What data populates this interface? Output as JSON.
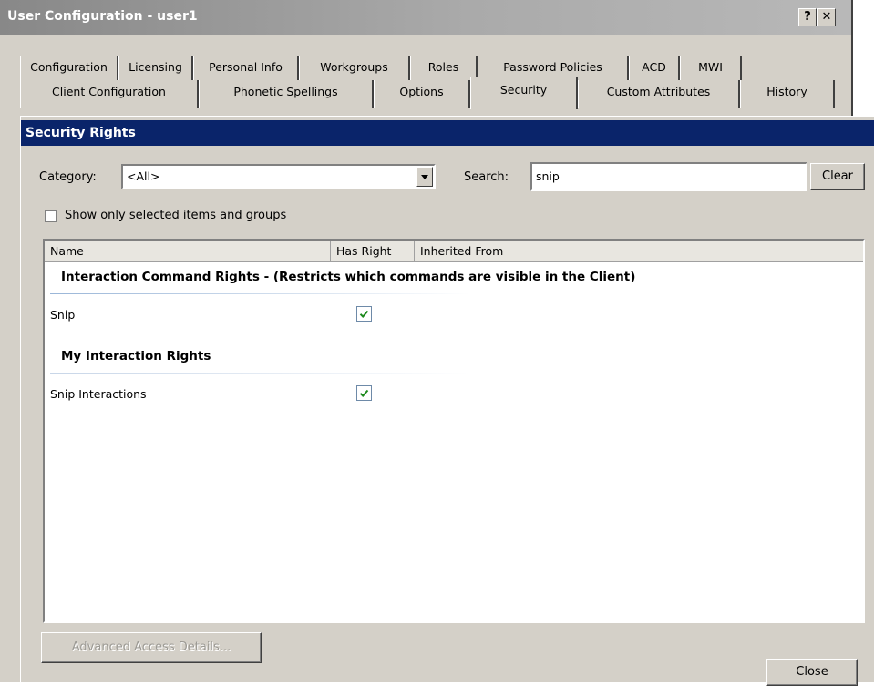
{
  "window": {
    "title": "User Configuration - user1",
    "help_label": "?",
    "close_label": "✕"
  },
  "tabs_row1": [
    "Configuration",
    "Licensing",
    "Personal Info",
    "Workgroups",
    "Roles",
    "Password Policies",
    "ACD",
    "MWI"
  ],
  "tabs_row2": [
    "Client Configuration",
    "Phonetic Spellings",
    "Options",
    "Security",
    "Custom Attributes",
    "History"
  ],
  "active_tab": "Security",
  "section": {
    "title": "Security Rights"
  },
  "filters": {
    "category_label": "Category:",
    "category_value": "<All>",
    "search_label": "Search:",
    "search_value": "snip",
    "clear_label": "Clear",
    "show_selected_label": "Show only selected items and groups",
    "show_selected_checked": false
  },
  "table": {
    "columns": [
      "Name",
      "Has Right",
      "Inherited From"
    ],
    "groups": [
      {
        "title": "Interaction Command Rights - (Restricts which commands are visible in the Client)",
        "rows": [
          {
            "name": "Snip",
            "has_right": true,
            "inherited_from": ""
          }
        ]
      },
      {
        "title": "My Interaction Rights",
        "rows": [
          {
            "name": "Snip Interactions",
            "has_right": true,
            "inherited_from": ""
          }
        ]
      }
    ]
  },
  "buttons": {
    "advanced_label": "Advanced Access Details...",
    "close_label": "Close"
  },
  "colors": {
    "section_header_bg": "#0a246a",
    "check_green": "#1e8a1e"
  },
  "icons": [
    "help-icon",
    "close-icon",
    "chevron-down-icon",
    "checkmark-icon"
  ]
}
